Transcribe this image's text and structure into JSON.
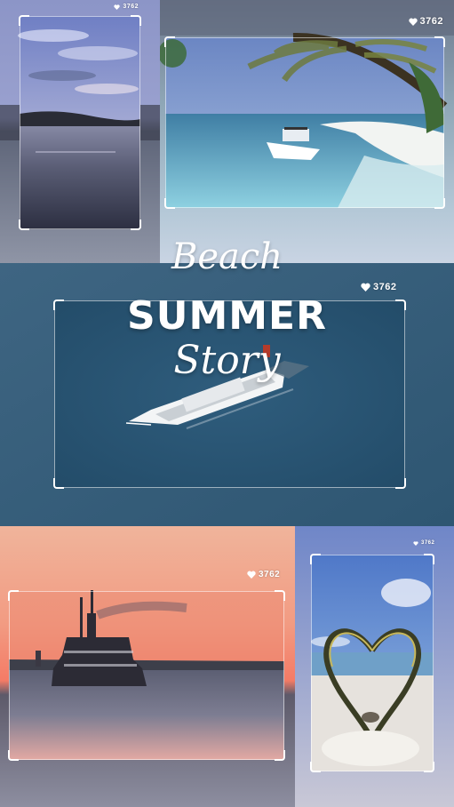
{
  "story": {
    "title_line1": "Beach",
    "title_line2": "SUMMER",
    "title_line3": "Story"
  },
  "photos": [
    {
      "id": "lake-dusk",
      "likes": "3762"
    },
    {
      "id": "tropical-beach-boat",
      "likes": "3762"
    },
    {
      "id": "aerial-ferry",
      "likes": "3762"
    },
    {
      "id": "sunset-ferry",
      "likes": "3762"
    },
    {
      "id": "heart-palm-beach",
      "likes": "3762"
    }
  ],
  "icons": {
    "like": "heart-icon"
  },
  "colors": {
    "background": "#2e5672",
    "frame": "#ffffff",
    "text": "#ffffff"
  }
}
